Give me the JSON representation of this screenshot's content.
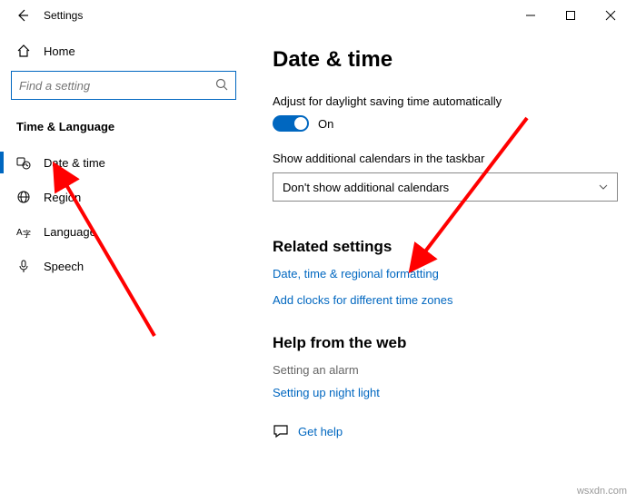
{
  "titlebar": {
    "app_title": "Settings"
  },
  "sidebar": {
    "home": "Home",
    "search_placeholder": "Find a setting",
    "section": "Time & Language",
    "items": [
      {
        "label": "Date & time"
      },
      {
        "label": "Region"
      },
      {
        "label": "Language"
      },
      {
        "label": "Speech"
      }
    ]
  },
  "content": {
    "title": "Date & time",
    "daylight_label": "Adjust for daylight saving time automatically",
    "toggle_state": "On",
    "calendars_label": "Show additional calendars in the taskbar",
    "calendars_value": "Don't show additional calendars",
    "related_heading": "Related settings",
    "link_regional": "Date, time & regional formatting",
    "link_clocks": "Add clocks for different time zones",
    "help_heading": "Help from the web",
    "help_muted": "Setting an alarm",
    "link_nightlight": "Setting up night light",
    "get_help": "Get help"
  },
  "watermark": "wsxdn.com"
}
